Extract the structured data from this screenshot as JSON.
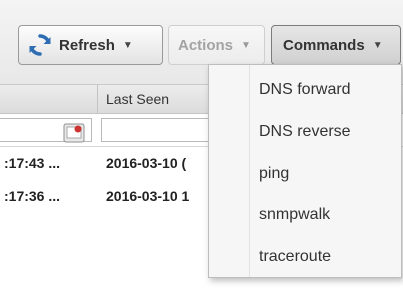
{
  "toolbar": {
    "refresh_label": "Refresh",
    "actions_label": "Actions",
    "commands_label": "Commands"
  },
  "grid": {
    "header": {
      "last_seen": "Last Seen"
    },
    "rows": [
      {
        "first_seen": ":17:43 ...",
        "last_seen": "2016-03-10 ("
      },
      {
        "first_seen": ":17:36 ...",
        "last_seen": "2016-03-10 1"
      }
    ]
  },
  "commands_menu": {
    "items": [
      "DNS forward",
      "DNS reverse",
      "ping",
      "snmpwalk",
      "traceroute"
    ]
  },
  "icons": {
    "refresh": "refresh-icon",
    "filter": "filter-icon",
    "caret": "chevron-down-icon"
  },
  "colors": {
    "refresh_icon": "#2f6db3",
    "filter_icon_accent": "#cc3333"
  }
}
